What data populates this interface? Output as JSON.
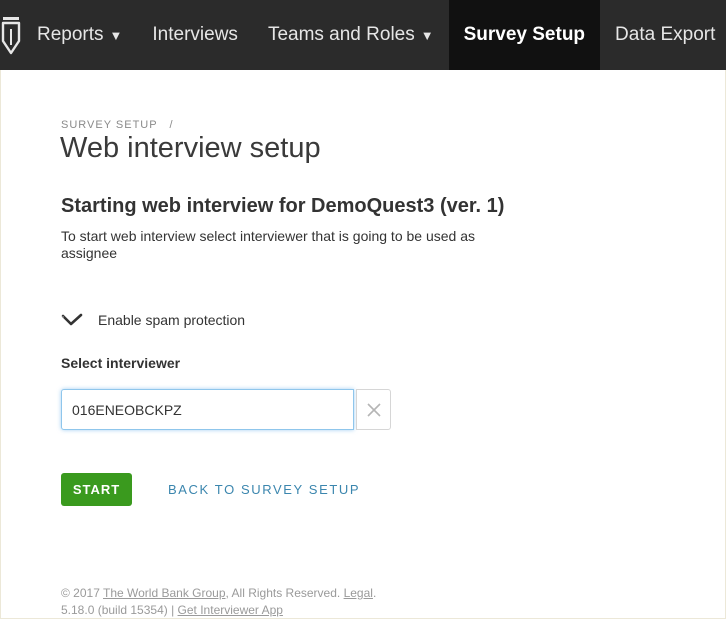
{
  "nav": {
    "reports": "Reports",
    "interviews": "Interviews",
    "teams_and_roles": "Teams and Roles",
    "survey_setup": "Survey Setup",
    "data_export": "Data Export",
    "caret": "▼"
  },
  "breadcrumb": {
    "item": "SURVEY SETUP",
    "separator": "/"
  },
  "page_title": "Web interview setup",
  "sub_title": "Starting web interview for DemoQuest3 (ver. 1)",
  "description": "To start web interview select interviewer that is going to be used as assignee",
  "spam_protection": {
    "label": "Enable spam protection",
    "checked": true
  },
  "select_interviewer": {
    "label": "Select interviewer",
    "value": "016ENEOBCKPZ"
  },
  "buttons": {
    "start": "START",
    "back": "BACK TO SURVEY SETUP"
  },
  "footer": {
    "copyright_prefix": "© 2017",
    "org_link": "The World Bank Group",
    "rights": ", All Rights Reserved.",
    "legal_link": "Legal",
    "period": ".",
    "version": "5.18.0 (build 15354) |",
    "app_link": "Get Interviewer App"
  },
  "colors": {
    "navbar": "#2b2b2b",
    "nav_active": "#111111",
    "start_button": "#3a9a1e",
    "link": "#3b86ae",
    "input_focus": "#8fc6ec"
  },
  "icons": {
    "logo": "pen-nib-logo-icon",
    "checkbox": "checkmark-icon",
    "clear": "close-icon"
  }
}
